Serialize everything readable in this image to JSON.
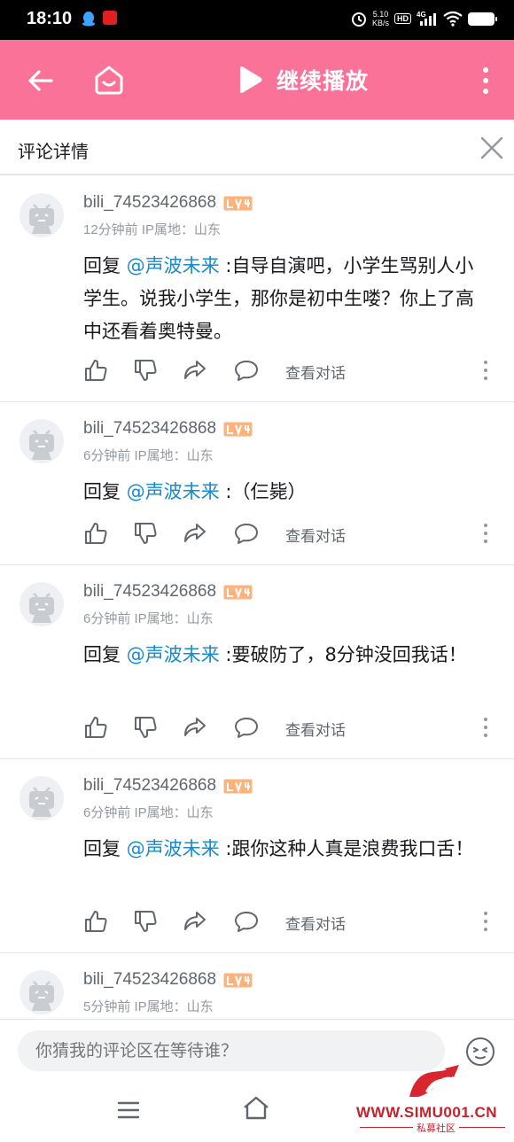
{
  "status_bar": {
    "time": "18:10",
    "net_speed_value": "5.10",
    "net_speed_unit": "KB/s",
    "hd": "HD",
    "network": "4G"
  },
  "top_bar": {
    "continue_label": "继续播放",
    "accent_color": "#fb7299"
  },
  "section": {
    "title": "评论详情"
  },
  "comments": [
    {
      "username": "bili_74523426868",
      "time_location": "12分钟前 IP属地：山东",
      "reply_prefix": "回复 ",
      "mention": "@声波未来",
      "text": " :自导自演吧，小学生骂别人小学生。说我小学生，那你是初中生喽？你上了高中还看着奥特曼。",
      "view_chat": "查看对话"
    },
    {
      "username": "bili_74523426868",
      "time_location": "6分钟前 IP属地：山东",
      "reply_prefix": "回复 ",
      "mention": "@声波未来",
      "text": " :（仨毙）",
      "view_chat": "查看对话"
    },
    {
      "username": "bili_74523426868",
      "time_location": "6分钟前 IP属地：山东",
      "reply_prefix": "回复 ",
      "mention": "@声波未来",
      "text": " :要破防了，8分钟没回我话！",
      "view_chat": "查看对话"
    },
    {
      "username": "bili_74523426868",
      "time_location": "6分钟前 IP属地：山东",
      "reply_prefix": "回复 ",
      "mention": "@声波未来",
      "text": " :跟你这种人真是浪费我口舌！",
      "view_chat": "查看对话"
    },
    {
      "username": "bili_74523426868",
      "time_location": "5分钟前 IP属地：山东"
    }
  ],
  "input": {
    "placeholder": "你猜我的评论区在等待谁？"
  },
  "watermark": {
    "text": "WWW.SIMU001.CN",
    "sub": "私募社区"
  }
}
